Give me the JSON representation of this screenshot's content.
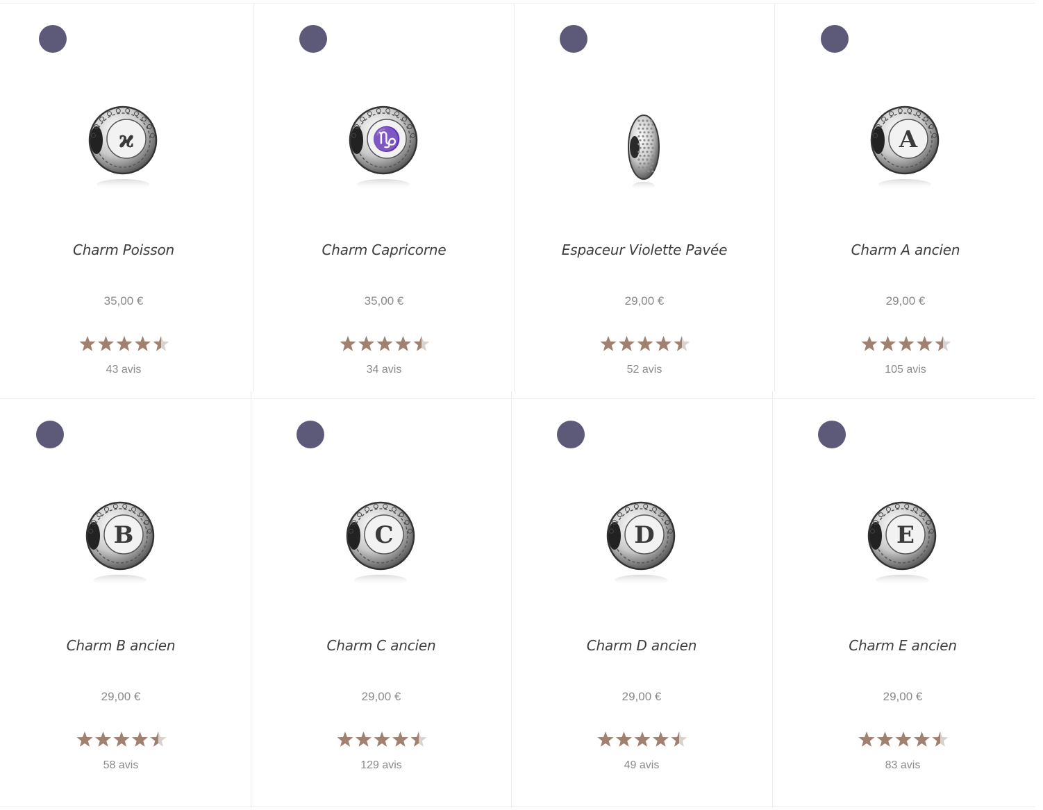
{
  "colors": {
    "badge": "#5c5a78",
    "star": "#a0806f",
    "star_empty": "#d8d2ce",
    "name": "#3d3d3d",
    "meta": "#8a8a8a"
  },
  "products": [
    {
      "name": "Charm Poisson",
      "price": "35,00 €",
      "rating": 4.5,
      "reviews": "43 avis",
      "image": "round-charm-pisces",
      "glyph": "ϰ"
    },
    {
      "name": "Charm Capricorne",
      "price": "35,00 €",
      "rating": 4.5,
      "reviews": "34 avis",
      "image": "round-charm-capricorn",
      "glyph": "♑"
    },
    {
      "name": "Espaceur Violette Pavée",
      "price": "29,00 €",
      "rating": 4.5,
      "reviews": "52 avis",
      "image": "pave-spacer",
      "glyph": ""
    },
    {
      "name": "Charm A ancien",
      "price": "29,00 €",
      "rating": 4.5,
      "reviews": "105 avis",
      "image": "round-charm-letter-a",
      "glyph": "A"
    },
    {
      "name": "Charm B ancien",
      "price": "29,00 €",
      "rating": 4.5,
      "reviews": "58 avis",
      "image": "round-charm-letter-b",
      "glyph": "B"
    },
    {
      "name": "Charm C ancien",
      "price": "29,00 €",
      "rating": 4.5,
      "reviews": "129 avis",
      "image": "round-charm-letter-c",
      "glyph": "C"
    },
    {
      "name": "Charm D ancien",
      "price": "29,00 €",
      "rating": 4.5,
      "reviews": "49 avis",
      "image": "round-charm-letter-d",
      "glyph": "D"
    },
    {
      "name": "Charm E ancien",
      "price": "29,00 €",
      "rating": 4.5,
      "reviews": "83 avis",
      "image": "round-charm-letter-e",
      "glyph": "E"
    }
  ]
}
